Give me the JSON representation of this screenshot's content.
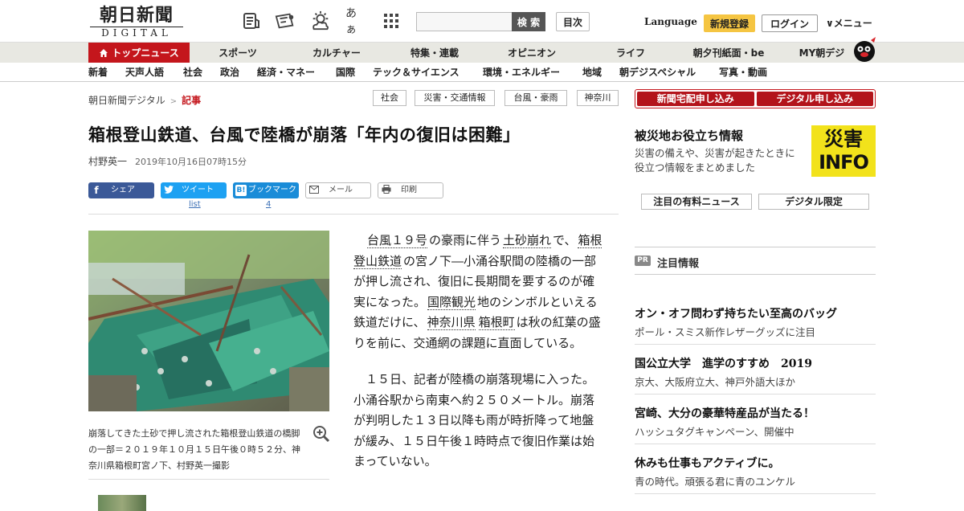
{
  "header": {
    "logo_top": "朝日新聞",
    "logo_bottom": "DIGITAL",
    "search_placeholder": "",
    "search_button": "検 索",
    "toc_button": "目次",
    "language": "Language",
    "register": "新規登録",
    "login": "ログイン",
    "menu": "∨メニュー",
    "icons": [
      "paper-list-icon",
      "subscription-icon",
      "weather-icon",
      "font-size-icon",
      "grid-icon"
    ],
    "font_size_glyph": "あぁ"
  },
  "main_nav": [
    "トップニュース",
    "スポーツ",
    "カルチャー",
    "特集・連載",
    "オピニオン",
    "ライフ",
    "朝夕刊紙面・be",
    "MY朝デジ"
  ],
  "sub_nav": [
    "新着",
    "天声人語",
    "社会",
    "政治",
    "経済・マネー",
    "国際",
    "テック＆サイエンス",
    "環境・エネルギー",
    "地域",
    "朝デジスペシャル",
    "写真・動画"
  ],
  "breadcrumb": {
    "home": "朝日新聞デジタル",
    "sep": ">",
    "current": "記事"
  },
  "tags": [
    "社会",
    "災害・交通情報",
    "台風・豪雨",
    "神奈川"
  ],
  "article": {
    "headline": "箱根登山鉄道、台風で陸橋が崩落「年内の復旧は困難」",
    "author": "村野英一",
    "date": "2019年10月16日07時15分",
    "share": {
      "facebook": "シェア",
      "twitter": "ツイート",
      "twitter_count": "list",
      "hatena": "ブックマーク",
      "hatena_count": "4",
      "mail": "メール",
      "print": "印刷"
    },
    "caption": "崩落してきた土砂で押し流された箱根登山鉄道の橋脚の一部＝２０１９年１０月１５日午後０時５２分、神奈川県箱根町宮ノ下、村野英一撮影",
    "p1": {
      "l1": "台風１９号",
      "t1": "の豪雨に伴う",
      "l2": "土砂崩れ",
      "t2": "で、",
      "l3": "箱根登山鉄道",
      "t3": "の宮ノ下―小涌谷駅間の陸橋の一部が押し流され、復旧に長期間を要するのが確実になった。",
      "l4": "国際観光",
      "t4": "地のシンボルといえる鉄道だけに、",
      "l5": "神奈川県",
      "l6": "箱根町",
      "t5": "は秋の紅葉の盛りを前に、交通網の課題に直面している。"
    },
    "p2": "１５日、記者が陸橋の崩落現場に入った。小涌谷駅から南東へ約２５０メートル。崩落が判明した１３日以降も雨が時折降って地盤が緩み、１５日午後１時時点で復旧作業は始まっていない。"
  },
  "sidebar": {
    "subscribe_home": "新聞宅配申し込み",
    "subscribe_digital": "デジタル申し込み",
    "disaster_title": "被災地お役立ち情報",
    "disaster_desc": "災害の備えや、災害が起きたときに役立つ情報をまとめました",
    "disaster_logo_top": "災害",
    "disaster_logo_bottom": "INFO",
    "paid_news": "注目の有料ニュース",
    "digital_only": "デジタル限定",
    "pr_badge": "PR",
    "pr_title": "注目情報",
    "promos": [
      {
        "title": "オン・オフ問わず持ちたい至高のバッグ",
        "sub": "ポール・スミス新作レザーグッズに注目"
      },
      {
        "title": "国公立大学　進学のすすめ　2019",
        "sub": "京大、大阪府立大、神戸外語大ほか"
      },
      {
        "title": "宮崎、大分の豪華特産品が当たる！",
        "sub": "ハッシュタグキャンペーン、開催中"
      },
      {
        "title": "休みも仕事もアクティブに。",
        "sub": "青の時代。頑張る君に青のユンケル"
      }
    ]
  },
  "colors": {
    "brand_red": "#c4161c",
    "register_yellow": "#f5c542",
    "facebook": "#3b5998",
    "twitter": "#1da1f2",
    "hatena": "#1a8cd8",
    "disaster_yellow": "#f2e21b"
  }
}
